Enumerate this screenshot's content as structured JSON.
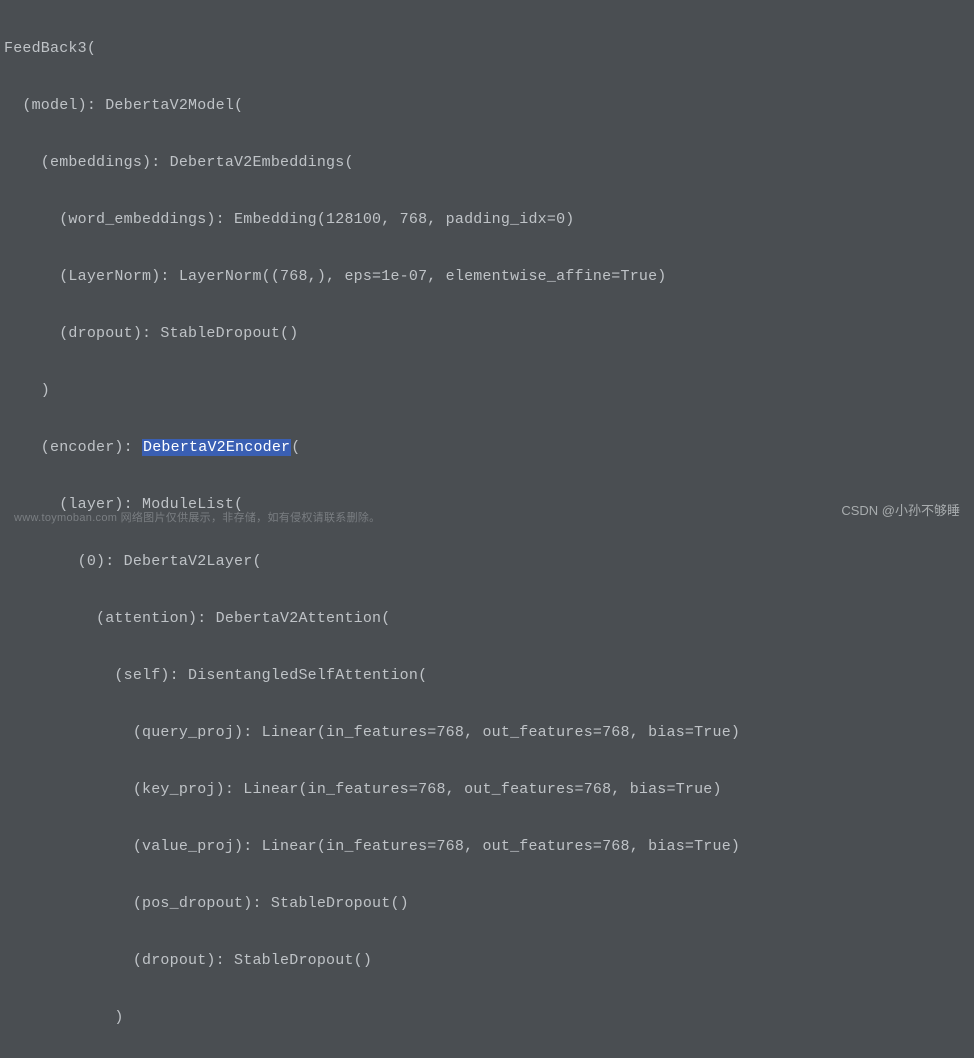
{
  "code": {
    "line1": "FeedBack3(",
    "line2": "  (model): DebertaV2Model(",
    "line3": "    (embeddings): DebertaV2Embeddings(",
    "line4": "      (word_embeddings): Embedding(128100, 768, padding_idx=0)",
    "line5": "      (LayerNorm): LayerNorm((768,), eps=1e-07, elementwise_affine=True)",
    "line6": "      (dropout): StableDropout()",
    "line7": "    )",
    "line8_pre": "    (encoder): ",
    "line8_highlight": "DebertaV2Encoder",
    "line8_post": "(",
    "line9": "      (layer): ModuleList(",
    "line10": "        (0): DebertaV2Layer(",
    "line11": "          (attention): DebertaV2Attention(",
    "line12": "            (self): DisentangledSelfAttention(",
    "line13": "              (query_proj): Linear(in_features=768, out_features=768, bias=True)",
    "line14": "              (key_proj): Linear(in_features=768, out_features=768, bias=True)",
    "line15": "              (value_proj): Linear(in_features=768, out_features=768, bias=True)",
    "line16": "              (pos_dropout): StableDropout()",
    "line17": "              (dropout): StableDropout()",
    "line18": "            )"
  },
  "watermarks": {
    "bottom_left": "www.toymoban.com 网络图片仅供展示，非存储，如有侵权请联系删除。",
    "bottom_right": "CSDN @小孙不够睡"
  }
}
